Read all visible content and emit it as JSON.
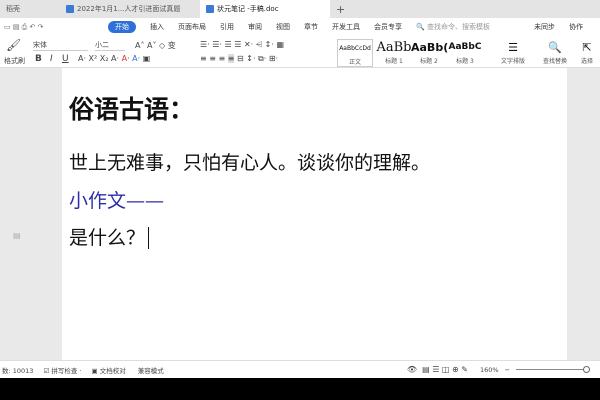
{
  "tabs": [
    {
      "label": "稻壳"
    },
    {
      "label": "2022年1月1...人才引进面试真题"
    },
    {
      "label": "状元笔记 -手稿.doc"
    }
  ],
  "new_tab": "+",
  "menu": {
    "items": [
      "开始",
      "插入",
      "页面布局",
      "引用",
      "审阅",
      "视图",
      "章节",
      "开发工具",
      "会员专享"
    ],
    "search_placeholder": "查找命令、搜索模板",
    "sync": "未同步",
    "collab": "协作"
  },
  "toolbar": {
    "format_painter": "格式刷",
    "font": "宋体",
    "size": "小二",
    "bold": "B",
    "italic": "I",
    "underline": "U",
    "styles": [
      {
        "sample": "AaBbCcDd",
        "label": "正文"
      },
      {
        "sample": "AaBb",
        "label": "标题 1"
      },
      {
        "sample": "AaBb(",
        "label": "标题 2"
      },
      {
        "sample": "AaBbC",
        "label": "标题 3"
      }
    ],
    "text_layout": "文字排版",
    "find_replace": "查找替换",
    "select": "选择"
  },
  "document": {
    "lines": [
      "俗语古语：",
      "世上无难事，只怕有心人。谈谈你的理解。",
      "小作文——",
      "是什么？"
    ],
    "accent": "#2e2ea8"
  },
  "status": {
    "word_count": "数: 10013",
    "spell": "拼写检查",
    "proof": "文档校对",
    "compat": "兼容模式",
    "zoom": "160%"
  }
}
